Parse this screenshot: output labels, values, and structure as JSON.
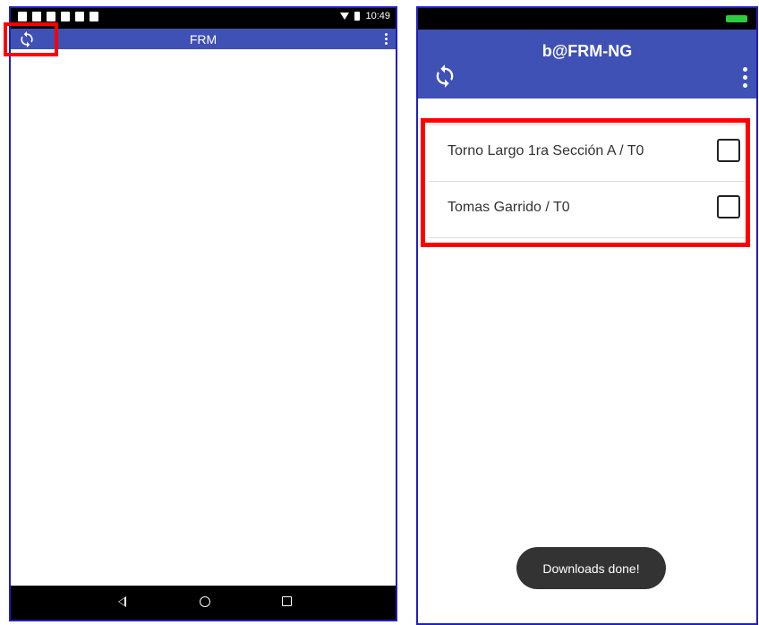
{
  "left_screen": {
    "status_bar": {
      "time": "10:49"
    },
    "app_bar": {
      "title": "FRM",
      "sync_icon": "sync-icon",
      "menu_icon": "more-vert-icon"
    },
    "nav_bar": {
      "back_icon": "back-icon",
      "home_icon": "home-icon",
      "recent_icon": "recent-apps-icon"
    }
  },
  "right_screen": {
    "app_bar": {
      "title": "b@FRM-NG",
      "sync_icon": "sync-icon",
      "menu_icon": "more-vert-icon"
    },
    "list": [
      {
        "label": "Torno Largo 1ra Sección A / T0",
        "checked": false
      },
      {
        "label": "Tomas Garrido / T0",
        "checked": false
      }
    ],
    "toast": "Downloads done!"
  },
  "colors": {
    "app_bar": "#3f51b5",
    "highlight": "#ff0000",
    "frame_border": "#1f1fc2",
    "battery": "#2ecc40"
  }
}
